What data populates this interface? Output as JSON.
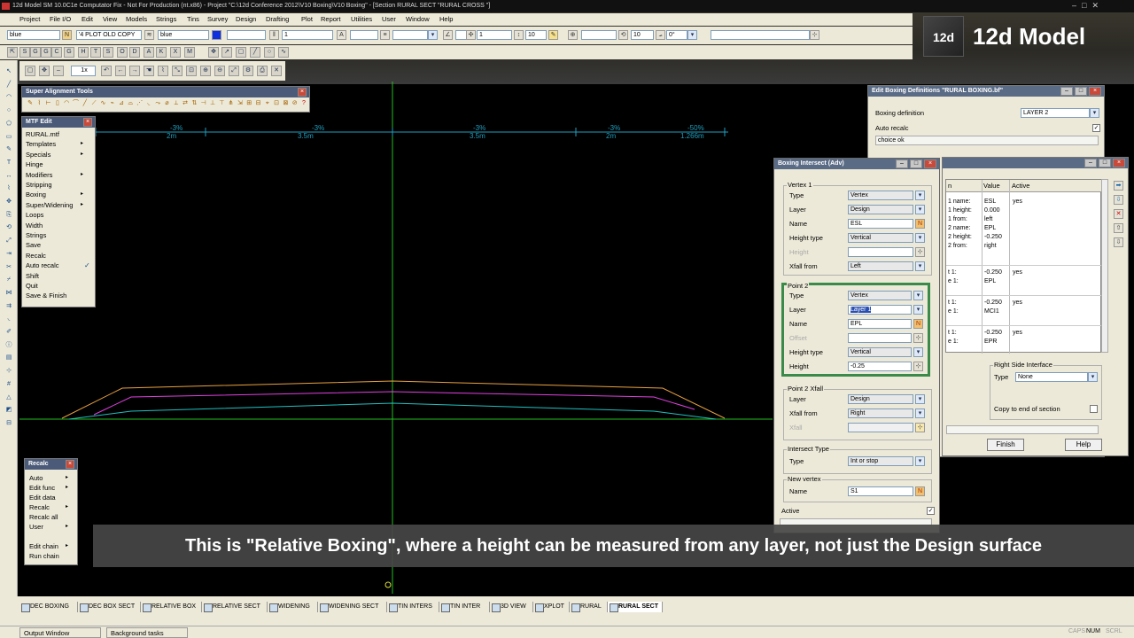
{
  "window": {
    "title": "12d Model SM 10.0C1e Computator Fix - Not For Production (nt.x86) - Project \"C:\\12d Conference 2012\\V10 Boxing\\V10 Boxing\" - [Section RURAL SECT \"RURAL CROSS \"]"
  },
  "menubar": [
    "Project",
    "File I/O",
    "Edit",
    "View",
    "Models",
    "Strings",
    "Tins",
    "Survey",
    "Design",
    "Drafting",
    "Plot",
    "Report",
    "Utilities",
    "User",
    "Window",
    "Help"
  ],
  "toolbar1": {
    "colour": "blue",
    "plot_name": "'4 PLOT OLD COPY",
    "colour2": "blue",
    "weight": "1",
    "value1": "1",
    "value2": "10",
    "value3": "10",
    "angle": "0°"
  },
  "toolbar2": {
    "zoom": "1x"
  },
  "logo": {
    "text": "12d Model",
    "cube": "12d"
  },
  "sat": {
    "title": "Super Alignment Tools"
  },
  "mtf": {
    "title": "MTF Edit",
    "items": [
      "RURAL.mtf",
      "Templates",
      "Specials",
      "Hinge",
      "Modifiers",
      "Stripping",
      "Boxing",
      "Super/Widening",
      "Loops",
      "Width",
      "Strings",
      "Save",
      "Recalc",
      "Auto recalc",
      "Shift",
      "Quit",
      "Save & Finish"
    ]
  },
  "recalc": {
    "title": "Recalc",
    "items": [
      "Auto",
      "Edit func",
      "Edit data",
      "Recalc",
      "Recalc all",
      "User",
      "Edit chain",
      "Run chain"
    ]
  },
  "canvas": {
    "grades": [
      "-3%",
      "-3%",
      "-3%",
      "-3%",
      "-50%"
    ],
    "widths": [
      "2m",
      "3.5m",
      "3.5m",
      "2m",
      "1.266m"
    ]
  },
  "ebd": {
    "title": "Edit Boxing Definitions \"RURAL BOXING.bf\"",
    "boxing_label": "Boxing definition",
    "boxing_value": "LAYER 2",
    "auto_recalc_label": "Auto recalc",
    "msg": "choice ok",
    "headers": [
      "n",
      "Value",
      "Active"
    ],
    "rows": [
      {
        "left": "1 name:\n1 height:\n1 from:\n2 name:\n2 height:\n2 from:",
        "value": "ESL\n0.000\nleft\nEPL\n-0.250\nright",
        "active": "yes"
      },
      {
        "left": "t 1:\ne 1:",
        "value": "-0.250\nEPL",
        "active": "yes"
      },
      {
        "left": "t 1:\ne 1:",
        "value": "-0.250\nMCI1",
        "active": "yes"
      },
      {
        "left": "t 1:\ne 1:",
        "value": "-0.250\nEPR",
        "active": "yes"
      }
    ],
    "rsi_label": "Right Side Interface",
    "rsi_type_label": "Type",
    "rsi_type_value": "None",
    "copy_label": "Copy to end of section",
    "finish": "Finish",
    "help": "Help"
  },
  "bia": {
    "title": "Boxing Intersect (Adv)",
    "v1": {
      "group": "Vertex 1",
      "type_l": "Type",
      "type_v": "Vertex",
      "layer_l": "Layer",
      "layer_v": "Design",
      "name_l": "Name",
      "name_v": "ESL",
      "ht_l": "Height type",
      "ht_v": "Vertical",
      "h_l": "Height",
      "xf_l": "Xfall from",
      "xf_v": "Left"
    },
    "p2": {
      "group": "Point 2",
      "type_l": "Type",
      "type_v": "Vertex",
      "layer_l": "Layer",
      "layer_v": "Layer 1",
      "name_l": "Name",
      "name_v": "EPL",
      "off_l": "Offset",
      "ht_l": "Height type",
      "ht_v": "Vertical",
      "h_l": "Height",
      "h_v": "-0.25"
    },
    "p2x": {
      "group": "Point 2 Xfall",
      "layer_l": "Layer",
      "layer_v": "Design",
      "xf_l": "Xfall from",
      "xf_v": "Right",
      "x_l": "Xfall"
    },
    "it": {
      "group": "Intersect Type",
      "type_l": "Type",
      "type_v": "Int or stop"
    },
    "nv": {
      "group": "New vertex",
      "name_l": "Name",
      "name_v": "S1"
    },
    "active_l": "Active"
  },
  "caption": {
    "pre": "This is \"Relative Boxing\", where a height can be measured from any ",
    "bold": "layer, not just the",
    "post": " Design surface"
  },
  "tabs": [
    "DEC BOXING",
    "DEC BOX SECT",
    "RELATIVE BOX",
    "RELATIVE SECT",
    "WIDENING",
    "WIDENING SECT",
    "TIN INTERS",
    "TIN INTER",
    "3D VIEW",
    "XPLOT",
    "RURAL",
    "RURAL SECT"
  ],
  "status": {
    "output": "Output Window",
    "bg": "Background tasks",
    "caps": "CAPS",
    "num": "NUM",
    "scrl": "SCRL"
  }
}
